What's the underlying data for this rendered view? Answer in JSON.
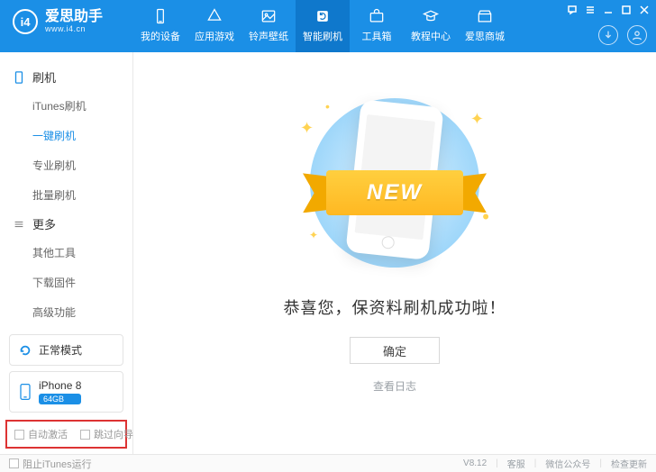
{
  "brand": {
    "name": "爱思助手",
    "url": "www.i4.cn",
    "logo_mark": "i4"
  },
  "nav": {
    "items": [
      {
        "label": "我的设备"
      },
      {
        "label": "应用游戏"
      },
      {
        "label": "铃声壁纸"
      },
      {
        "label": "智能刷机",
        "active": true
      },
      {
        "label": "工具箱"
      },
      {
        "label": "教程中心"
      },
      {
        "label": "爱思商城"
      }
    ]
  },
  "sidebar": {
    "groups": [
      {
        "title": "刷机",
        "items": [
          {
            "label": "iTunes刷机"
          },
          {
            "label": "一键刷机",
            "active": true
          },
          {
            "label": "专业刷机"
          },
          {
            "label": "批量刷机"
          }
        ]
      },
      {
        "title": "更多",
        "items": [
          {
            "label": "其他工具"
          },
          {
            "label": "下载固件"
          },
          {
            "label": "高级功能"
          }
        ]
      }
    ],
    "mode": "正常模式",
    "device": {
      "name": "iPhone 8",
      "capacity": "64GB"
    },
    "bottom_options": [
      {
        "label": "自动激活",
        "checked": false
      },
      {
        "label": "跳过向导",
        "checked": false
      }
    ]
  },
  "main": {
    "ribbon_text": "NEW",
    "success_text": "恭喜您，保资料刷机成功啦！",
    "ok_label": "确定",
    "log_link": "查看日志"
  },
  "footer": {
    "block_itunes_label": "阻止iTunes运行",
    "block_itunes_checked": false,
    "version": "V8.12",
    "links": [
      "客服",
      "微信公众号",
      "检查更新"
    ]
  }
}
